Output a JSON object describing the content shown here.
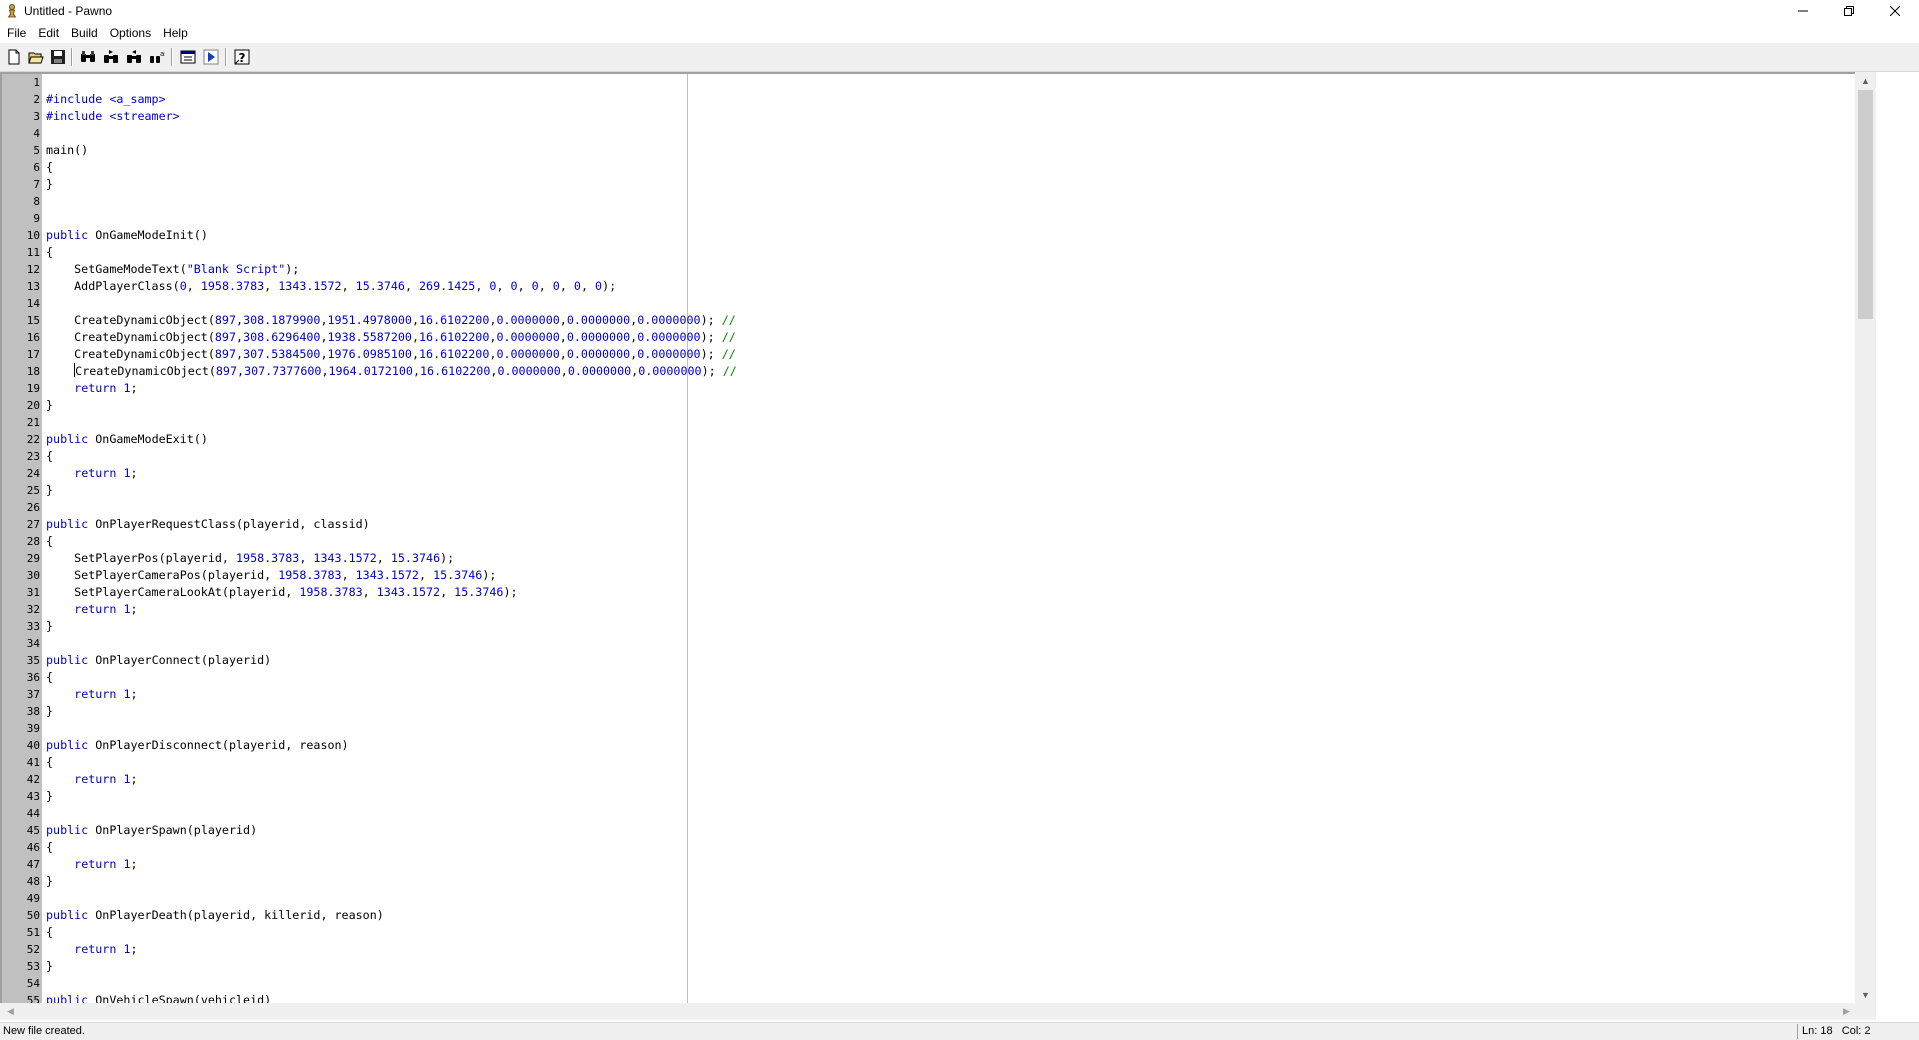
{
  "window": {
    "title": "Untitled - Pawno",
    "app_icon": "pawno-chess-pawn-icon",
    "controls": [
      "minimize-icon",
      "restore-icon",
      "close-icon"
    ]
  },
  "menu": [
    "File",
    "Edit",
    "Build",
    "Options",
    "Help"
  ],
  "toolbar": {
    "buttons": [
      {
        "name": "new-file-icon"
      },
      {
        "name": "open-file-icon"
      },
      {
        "name": "save-file-icon"
      },
      {
        "name": "find-icon"
      },
      {
        "name": "find-next-icon"
      },
      {
        "name": "find-previous-icon"
      },
      {
        "name": "replace-icon"
      },
      {
        "name": "function-list-icon"
      },
      {
        "name": "compile-run-icon"
      },
      {
        "name": "help-icon"
      }
    ]
  },
  "editor": {
    "line_count": 55,
    "caret_line": 18,
    "lines": [
      "",
      "#include <a_samp>",
      "#include <streamer>",
      "",
      "main()",
      "{",
      "}",
      "",
      "",
      "public OnGameModeInit()",
      "{",
      "    SetGameModeText(\"Blank Script\");",
      "    AddPlayerClass(0, 1958.3783, 1343.1572, 15.3746, 269.1425, 0, 0, 0, 0, 0, 0);",
      "",
      "    CreateDynamicObject(897,308.1879900,1951.4978000,16.6102200,0.0000000,0.0000000,0.0000000); //",
      "    CreateDynamicObject(897,308.6296400,1938.5587200,16.6102200,0.0000000,0.0000000,0.0000000); //",
      "    CreateDynamicObject(897,307.5384500,1976.0985100,16.6102200,0.0000000,0.0000000,0.0000000); //",
      "    CreateDynamicObject(897,307.7377600,1964.0172100,16.6102200,0.0000000,0.0000000,0.0000000); //",
      "    return 1;",
      "}",
      "",
      "public OnGameModeExit()",
      "{",
      "    return 1;",
      "}",
      "",
      "public OnPlayerRequestClass(playerid, classid)",
      "{",
      "    SetPlayerPos(playerid, 1958.3783, 1343.1572, 15.3746);",
      "    SetPlayerCameraPos(playerid, 1958.3783, 1343.1572, 15.3746);",
      "    SetPlayerCameraLookAt(playerid, 1958.3783, 1343.1572, 15.3746);",
      "    return 1;",
      "}",
      "",
      "public OnPlayerConnect(playerid)",
      "{",
      "    return 1;",
      "}",
      "",
      "public OnPlayerDisconnect(playerid, reason)",
      "{",
      "    return 1;",
      "}",
      "",
      "public OnPlayerSpawn(playerid)",
      "{",
      "    return 1;",
      "}",
      "",
      "public OnPlayerDeath(playerid, killerid, reason)",
      "{",
      "    return 1;",
      "}",
      "",
      "public OnVehicleSpawn(vehicleid)"
    ]
  },
  "status": {
    "message": "New file created.",
    "position": "Ln: 18   Col: 2"
  },
  "colors": {
    "keyword": "#0000c8",
    "comment": "#008000",
    "gutter": "#c0c0c0"
  }
}
